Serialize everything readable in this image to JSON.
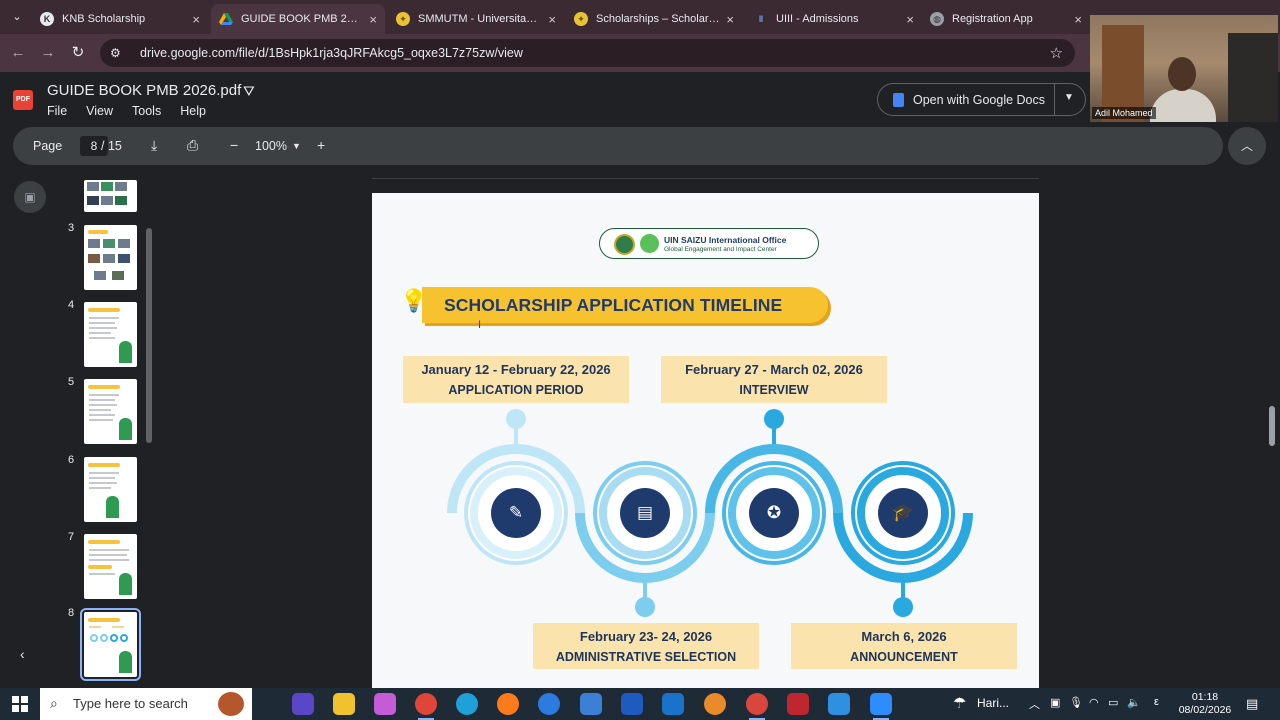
{
  "browser": {
    "tabs": [
      {
        "title": "KNB Scholarship",
        "active": false,
        "favicon": "knb-icon",
        "color": "#e8eaed"
      },
      {
        "title": "GUIDE BOOK PMB 2026.pdf",
        "active": true,
        "favicon": "google-drive-icon",
        "color": "#f8c33c"
      },
      {
        "title": "SMMUTM - Universitas Tr...",
        "active": false,
        "favicon": "university-seal-icon",
        "color": "#e8c234"
      },
      {
        "title": "Scholarships – Scholarship...",
        "active": false,
        "favicon": "university-seal-icon",
        "color": "#e8c234"
      },
      {
        "title": "UIII - Admissions",
        "active": false,
        "favicon": "uiii-icon",
        "color": "#6fa8ff"
      },
      {
        "title": "Registration App",
        "active": false,
        "favicon": "globe-icon",
        "color": "#9aa0a6"
      }
    ],
    "url": "drive.google.com/file/d/1BsHpk1rja3qJRFAkcg5_oqxe3L7z75zw/view"
  },
  "drive": {
    "file_title": "GUIDE BOOK PMB 2026.pdf",
    "file_badge": "PDF",
    "menu": [
      "File",
      "View",
      "Tools",
      "Help"
    ],
    "open_with": "Open with Google Docs"
  },
  "webcam": {
    "participant": "Adil Mohamed"
  },
  "pdf_controls": {
    "page_label": "Page",
    "current_page": "8",
    "total_pages": "/ 15",
    "zoom": "100%"
  },
  "thumbnails": [
    {
      "num": "",
      "kind": "photos"
    },
    {
      "num": "3",
      "kind": "photos"
    },
    {
      "num": "4",
      "kind": "text-figure"
    },
    {
      "num": "5",
      "kind": "text-figure"
    },
    {
      "num": "6",
      "kind": "text-figure"
    },
    {
      "num": "7",
      "kind": "text-figure"
    },
    {
      "num": "8",
      "kind": "timeline",
      "selected": true
    }
  ],
  "page": {
    "office_name": "UIN SAIZU International Office",
    "office_subtitle": "Global Engagement and Impact Center",
    "banner_title": "SCHOLARSHIP APPLICATION TIMELINE",
    "stages": [
      {
        "date": "January 12 - February 22, 2026",
        "name": "APPLICATION PERIOD",
        "icon": "pencil-cup-icon"
      },
      {
        "date": "February 23- 24, 2026",
        "name": "ADMINISTRATIVE SELECTION",
        "icon": "document-check-icon"
      },
      {
        "date": "February 27 -  March 02, 2026",
        "name": "INTERVIEW",
        "icon": "award-ribbon-icon"
      },
      {
        "date": "March 6, 2026",
        "name": "ANNOUNCEMENT",
        "icon": "graduation-cap-icon"
      }
    ],
    "colors": {
      "banner": "#f7c22f",
      "navy": "#1f3b6d",
      "ring_light": "#bfe6f7",
      "ring_mid": "#7ccdee",
      "ring_dark": "#2aa8e0",
      "date_box": "#fbe3ae"
    }
  },
  "taskbar": {
    "search_placeholder": "Type here to search",
    "weather": "Hari...",
    "language": "ε",
    "time": "01:18",
    "date": "08/02/2026"
  }
}
